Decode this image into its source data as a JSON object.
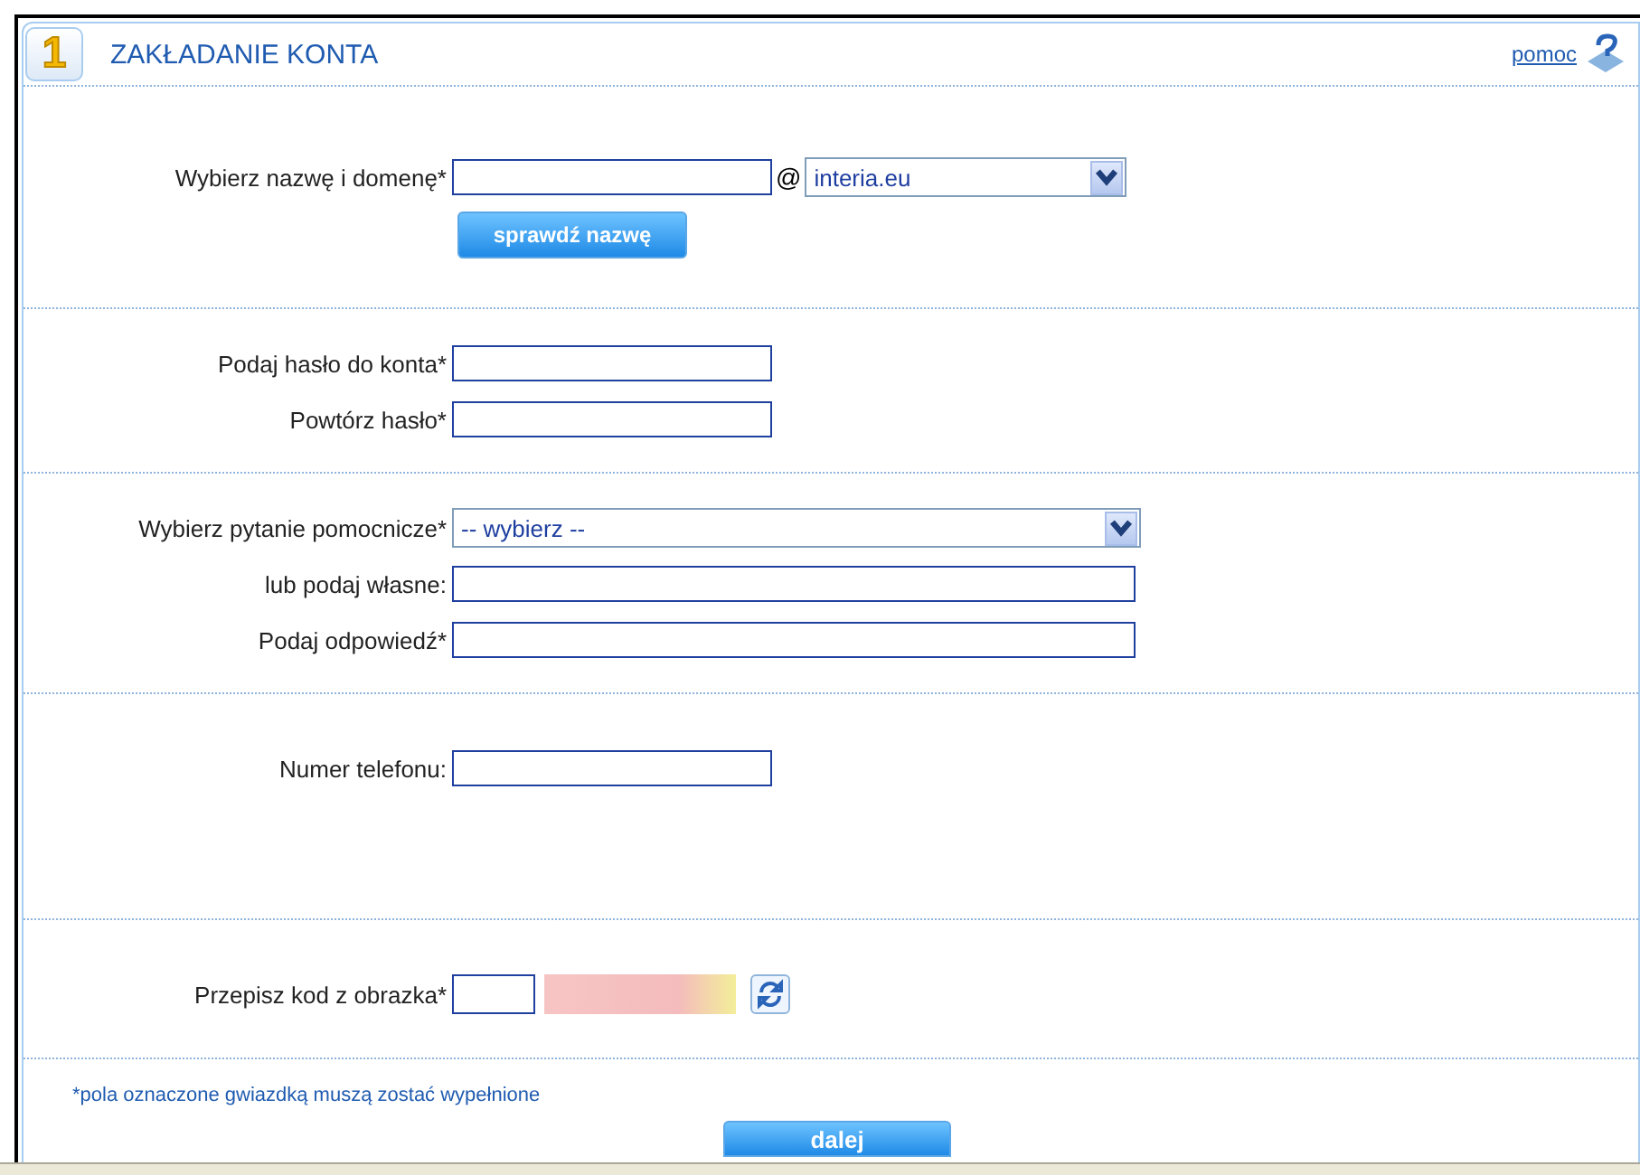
{
  "header": {
    "step": "1",
    "title": "ZAKŁADANIE KONTA",
    "help_link": "pomoc"
  },
  "sections": [
    {
      "rows": [
        {
          "kind": "login",
          "label": "Wybierz nazwę i domenę*",
          "at": "@",
          "domain": "interia.eu"
        },
        {
          "kind": "button",
          "label": "sprawdź nazwę"
        }
      ]
    },
    {
      "rows": [
        {
          "kind": "input",
          "label": "Podaj hasło do konta*"
        },
        {
          "kind": "input",
          "label": "Powtórz hasło*"
        }
      ]
    },
    {
      "rows": [
        {
          "kind": "select",
          "label": "Wybierz pytanie pomocnicze*",
          "value": "-- wybierz --"
        },
        {
          "kind": "wideinput",
          "label": "lub podaj własne:"
        },
        {
          "kind": "wideinput",
          "label": "Podaj odpowiedź*"
        }
      ]
    },
    {
      "rows": [
        {
          "kind": "input",
          "label": "Numer telefonu:"
        }
      ]
    },
    {
      "rows": [
        {
          "kind": "captcha",
          "label": "Przepisz kod z obrazka*"
        }
      ]
    }
  ],
  "note": "*pola oznaczone gwiazdką muszą zostać wypełnione",
  "submit": "dalej"
}
